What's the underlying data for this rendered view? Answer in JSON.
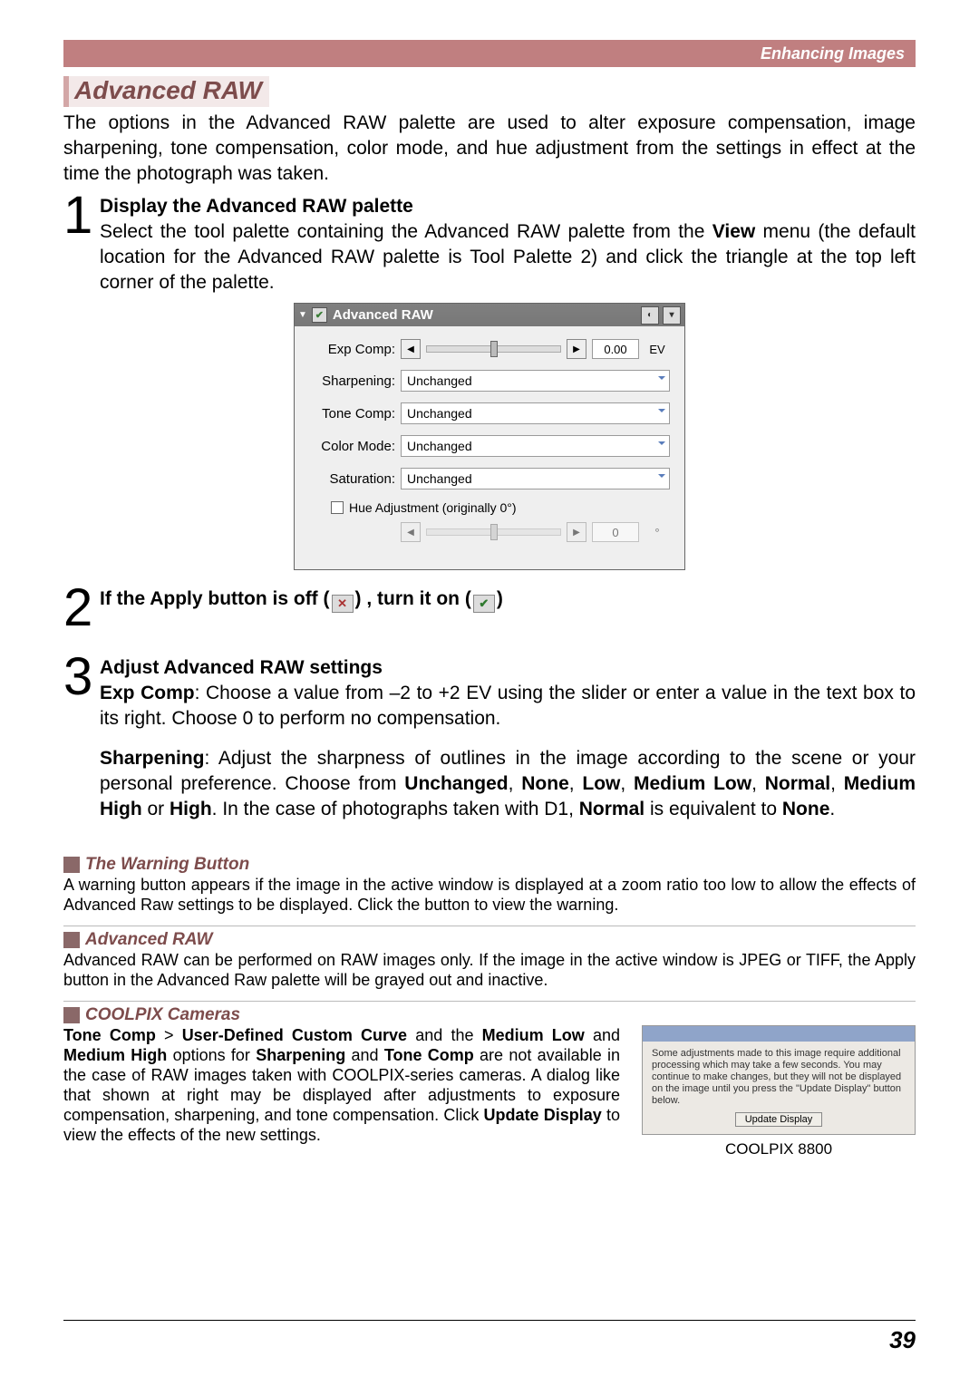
{
  "header": {
    "caption": "Enhancing Images"
  },
  "section_title": "Advanced RAW",
  "intro": "The options in the Advanced RAW palette are used to alter exposure compensation, image sharpening, tone compensation, color mode, and hue adjustment from the settings in effect at the time the photograph was taken.",
  "steps": {
    "s1": {
      "num": "1",
      "head": "Display the Advanced RAW palette",
      "pre": "Select the tool palette containing the Advanced RAW palette from the ",
      "view": "View",
      "post": " menu (the default location for the Advanced RAW palette is Tool Palette 2) and click the triangle at the top left corner of the palette."
    },
    "s2": {
      "num": "2",
      "pre": "If the Apply button is off (",
      "mid": ") , turn it on (",
      "post": ")"
    },
    "s3": {
      "num": "3",
      "head": "Adjust Advanced RAW settings",
      "exp_label": "Exp Comp",
      "exp_text": ": Choose a value from –2 to +2 EV using the slider or enter a value in the text box to its right.  Choose 0 to perform no compensation.",
      "sharp_label": "Sharpening",
      "sharp_pre": ": Adjust the sharpness of outlines in the image according to the scene or your personal preference.  Choose from ",
      "opts": {
        "unchanged": "Unchanged",
        "none": "None",
        "low": "Low",
        "medlow": "Medium Low",
        "normal": "Normal",
        "medhigh": "Medium High",
        "high": "High"
      },
      "sharp_mid": ".  In the case of photographs taken with D1, ",
      "sharp_post": " is equivalent to "
    }
  },
  "palette": {
    "title": "Advanced RAW",
    "expcomp": {
      "label": "Exp Comp:",
      "value": "0.00",
      "unit": "EV"
    },
    "sharp": {
      "label": "Sharpening:",
      "value": "Unchanged"
    },
    "tone": {
      "label": "Tone Comp:",
      "value": "Unchanged"
    },
    "color": {
      "label": "Color Mode:",
      "value": "Unchanged"
    },
    "sat": {
      "label": "Saturation:",
      "value": "Unchanged"
    },
    "hue": {
      "label": "Hue Adjustment (originally 0°)",
      "value": "0",
      "unit": "°"
    }
  },
  "notes": {
    "warn": {
      "title": "The Warning Button",
      "body": "A warning button appears if the image in the active window is displayed at a zoom ratio too low to allow the effects of Advanced Raw settings to be displayed.  Click the button to view the warning."
    },
    "adv": {
      "title": "Advanced RAW",
      "body": "Advanced RAW can be performed on RAW images only.  If the image in the active window is JPEG or TIFF, the Apply button in the Advanced Raw palette will be grayed out and inactive."
    },
    "cool": {
      "title": "COOLPIX Cameras",
      "b1": "Tone Comp",
      "gt": " > ",
      "b2": "User-Defined Custom Curve",
      "mid1": " and the ",
      "b3": "Medium Low",
      "mid2": " and ",
      "b4": "Medium High",
      "mid3": " options for ",
      "b5": "Sharpening",
      "mid4": " and ",
      "b6": "Tone Comp",
      "mid5": " are not available in the case of RAW images taken with COOLPIX-series cameras.  A dialog like that shown at right may be displayed after adjustments to exposure compensation, sharpening, and tone compensation.  Click ",
      "b7": "Update Display",
      "mid6": " to view the effects of the new settings.",
      "dlg_text": "Some adjustments made to this image require additional processing which may take a few seconds.  You may continue to make changes, but they will not be displayed on the image until you press the \"Update Display\" button below.",
      "dlg_btn": "Update Display",
      "dlg_caption": "COOLPIX 8800"
    }
  },
  "page_number": "39"
}
